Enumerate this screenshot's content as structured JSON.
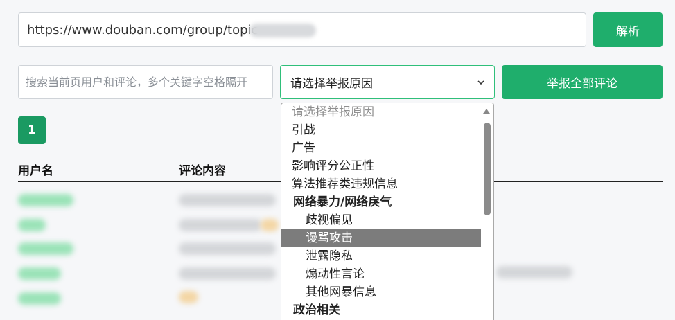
{
  "url_input": {
    "value": "https://www.douban.com/group/topic"
  },
  "parse_button": {
    "label": "解析"
  },
  "search": {
    "placeholder": "搜索当前页用户和评论，多个关键字空格隔开"
  },
  "reason_select": {
    "selected": "请选择举报原因"
  },
  "report_all_button": {
    "label": "举报全部评论"
  },
  "pagination": {
    "pages": [
      "1"
    ],
    "current": "1"
  },
  "table": {
    "headers": [
      "用户名",
      "评论内容"
    ]
  },
  "dropdown": {
    "options": [
      {
        "label": "请选择举报原因",
        "kind": "placeholder"
      },
      {
        "label": "引战",
        "kind": "option"
      },
      {
        "label": "广告",
        "kind": "option"
      },
      {
        "label": "影响评分公正性",
        "kind": "option"
      },
      {
        "label": "算法推荐类违规信息",
        "kind": "option"
      },
      {
        "label": "网络暴力/网络戾气",
        "kind": "group"
      },
      {
        "label": "歧视偏见",
        "kind": "sub"
      },
      {
        "label": "谩骂攻击",
        "kind": "sub",
        "hover": true
      },
      {
        "label": "泄露隐私",
        "kind": "sub"
      },
      {
        "label": "煽动性言论",
        "kind": "sub"
      },
      {
        "label": "其他网暴信息",
        "kind": "sub"
      },
      {
        "label": "政治相关",
        "kind": "group"
      }
    ]
  },
  "colors": {
    "accent": "#1fae6c",
    "page_active": "#1a9a62",
    "focus_border": "#2fbf7a"
  }
}
